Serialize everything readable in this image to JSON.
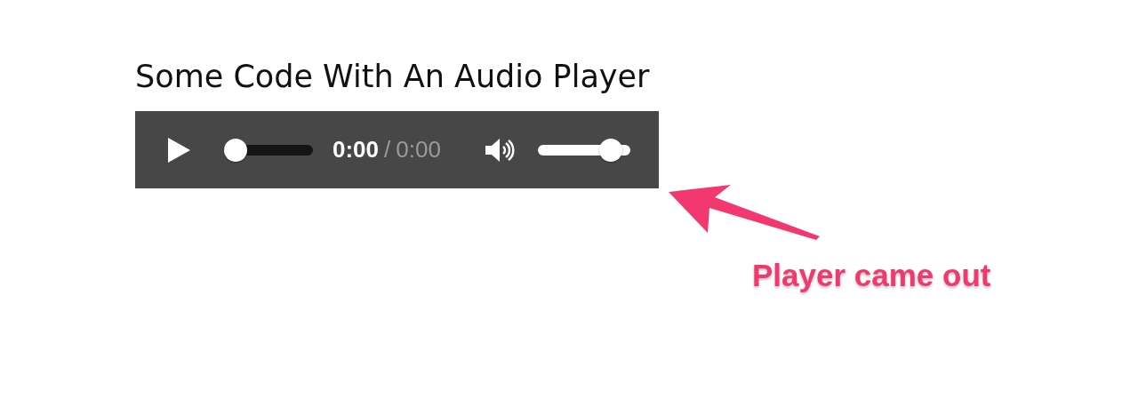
{
  "heading": "Some Code With An Audio Player",
  "player": {
    "progress": {
      "level": 0
    },
    "current_time": "0:00",
    "separator": "/",
    "duration": "0:00",
    "volume": {
      "level": 0.88
    }
  },
  "annotation": {
    "text": "Player came out"
  }
}
